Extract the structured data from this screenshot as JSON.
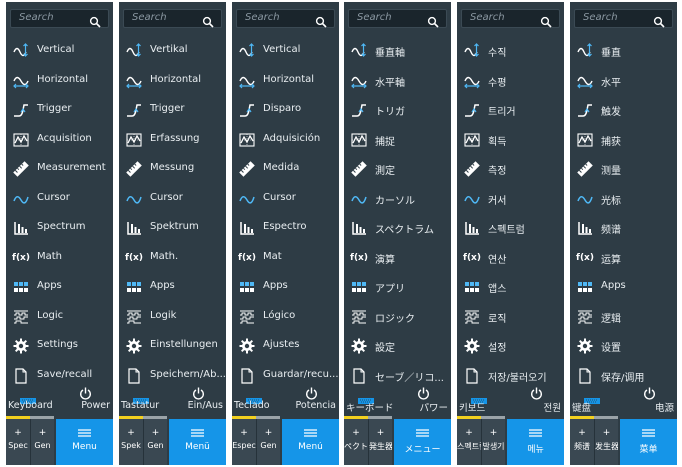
{
  "panels": [
    {
      "search_placeholder": "Search",
      "items": [
        "Vertical",
        "Horizontal",
        "Trigger",
        "Acquisition",
        "Measurement",
        "Cursor",
        "Spectrum",
        "Math",
        "Apps",
        "Logic",
        "Settings",
        "Save/recall"
      ],
      "keyboard": "Keyboard",
      "power": "Power",
      "tabs": [
        "Spec",
        "Gen",
        "Menu"
      ]
    },
    {
      "search_placeholder": "Search",
      "items": [
        "Vertikal",
        "Horizontal",
        "Trigger",
        "Erfassung",
        "Messung",
        "Cursor",
        "Spektrum",
        "Math.",
        "Apps",
        "Logik",
        "Einstellungen",
        "Speichern/Ab..."
      ],
      "keyboard": "Tastatur",
      "power": "Ein/Aus",
      "tabs": [
        "Spek",
        "Gen",
        "Menü"
      ]
    },
    {
      "search_placeholder": "Search",
      "items": [
        "Vertical",
        "Horizontal",
        "Disparo",
        "Adquisición",
        "Medida",
        "Cursor",
        "Espectro",
        "Mat",
        "Apps",
        "Lógico",
        "Ajustes",
        "Guardar/recu..."
      ],
      "keyboard": "Teclado",
      "power": "Potencia",
      "tabs": [
        "Espec",
        "Gen",
        "Menú"
      ]
    },
    {
      "search_placeholder": "Search",
      "items": [
        "垂直軸",
        "水平軸",
        "トリガ",
        "捕捉",
        "測定",
        "カーソル",
        "スペクトラム",
        "演算",
        "アプリ",
        "ロジック",
        "設定",
        "セーブ／リコ..."
      ],
      "keyboard": "キーボード",
      "power": "パワー",
      "tabs": [
        "ペクトラ",
        "発生器",
        "メニュー"
      ]
    },
    {
      "search_placeholder": "Search",
      "items": [
        "수직",
        "수평",
        "트리거",
        "획득",
        "측정",
        "커서",
        "스펙트럼",
        "연산",
        "앱스",
        "로직",
        "설정",
        "저장/불러오기"
      ],
      "keyboard": "키보드",
      "power": "전원",
      "tabs": [
        "스펙트럼",
        "발생기",
        "메뉴"
      ]
    },
    {
      "search_placeholder": "Search",
      "items": [
        "垂直",
        "水平",
        "触发",
        "捕获",
        "测量",
        "光标",
        "频谱",
        "运算",
        "Apps",
        "逻辑",
        "设置",
        "保存/调用"
      ],
      "keyboard": "键盘",
      "power": "电源",
      "tabs": [
        "频谱",
        "发生器",
        "菜单"
      ]
    }
  ],
  "item_icons": [
    "vertical-icon",
    "horizontal-icon",
    "trigger-icon",
    "acquisition-icon",
    "measurement-icon",
    "cursor-icon",
    "spectrum-icon",
    "math-icon",
    "apps-icon",
    "logic-icon",
    "settings-icon",
    "save-recall-icon"
  ],
  "math_icon_text": "f(x)",
  "colors": {
    "panel_bg": "#2e3c45",
    "accent_blue": "#1595e8",
    "strip_yellow": "#f2d01f",
    "text": "#e9eef1"
  }
}
